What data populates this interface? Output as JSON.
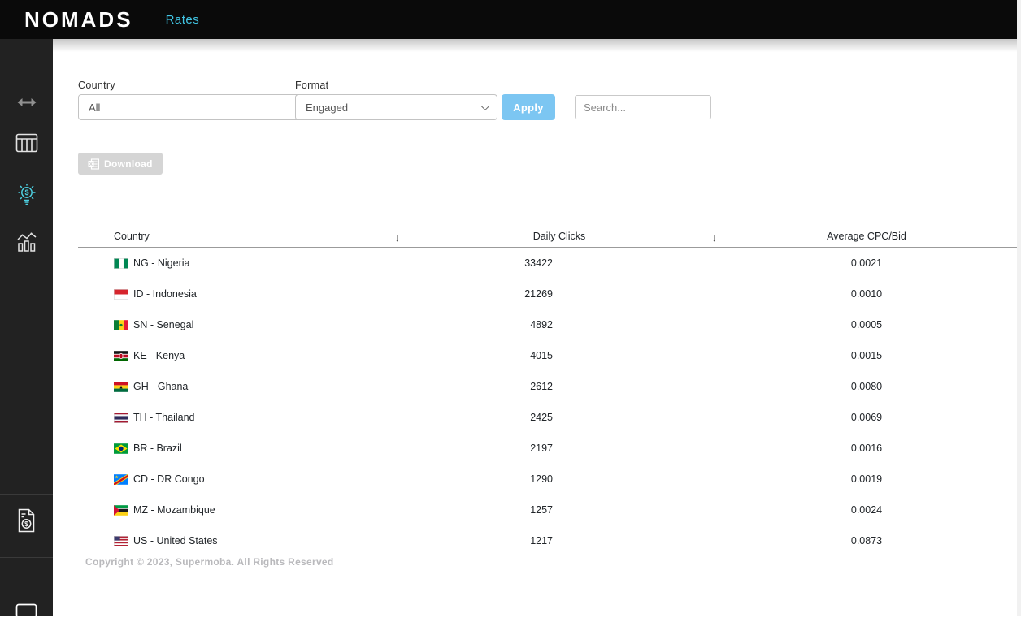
{
  "header": {
    "logo": "NOMADS",
    "rates_label": "Rates"
  },
  "sidebar": {
    "items": [
      {
        "icon": "resize-horizontal-icon"
      },
      {
        "icon": "table-columns-icon"
      },
      {
        "icon": "bulb-dollar-icon",
        "active": true
      },
      {
        "icon": "stats-chart-icon"
      },
      {
        "icon": "invoice-dollar-icon"
      },
      {
        "icon": "chat-icon"
      }
    ]
  },
  "filters": {
    "country": {
      "label": "Country",
      "value": "All"
    },
    "format": {
      "label": "Format",
      "value": "Engaged"
    },
    "apply_label": "Apply",
    "search_placeholder": "Search..."
  },
  "toolbar": {
    "download_label": "Download"
  },
  "table": {
    "sort_indicator": "↓",
    "columns": [
      {
        "label": "Country"
      },
      {
        "label": "Daily Clicks"
      },
      {
        "label": "Average CPC/Bid"
      }
    ],
    "rows": [
      {
        "code": "NG",
        "country": "NG - Nigeria",
        "daily_clicks": "33422",
        "avg_cpc_bid": "0.0021"
      },
      {
        "code": "ID",
        "country": "ID - Indonesia",
        "daily_clicks": "21269",
        "avg_cpc_bid": "0.0010"
      },
      {
        "code": "SN",
        "country": "SN - Senegal",
        "daily_clicks": "4892",
        "avg_cpc_bid": "0.0005"
      },
      {
        "code": "KE",
        "country": "KE - Kenya",
        "daily_clicks": "4015",
        "avg_cpc_bid": "0.0015"
      },
      {
        "code": "GH",
        "country": "GH - Ghana",
        "daily_clicks": "2612",
        "avg_cpc_bid": "0.0080"
      },
      {
        "code": "TH",
        "country": "TH - Thailand",
        "daily_clicks": "2425",
        "avg_cpc_bid": "0.0069"
      },
      {
        "code": "BR",
        "country": "BR - Brazil",
        "daily_clicks": "2197",
        "avg_cpc_bid": "0.0016"
      },
      {
        "code": "CD",
        "country": "CD - DR Congo",
        "daily_clicks": "1290",
        "avg_cpc_bid": "0.0019"
      },
      {
        "code": "MZ",
        "country": "MZ - Mozambique",
        "daily_clicks": "1257",
        "avg_cpc_bid": "0.0024"
      },
      {
        "code": "US",
        "country": "US - United States",
        "daily_clicks": "1217",
        "avg_cpc_bid": "0.0873"
      }
    ]
  },
  "footer": {
    "copyright": "Copyright © 2023, Supermoba. All Rights Reserved"
  },
  "colors": {
    "accent_cyan": "#41c6e5",
    "active_icon_cyan": "#4dd0e1",
    "apply_blue": "#7cc6f2",
    "header_bg": "#0a0a0a",
    "sidebar_bg": "#222222",
    "download_gray": "#d5d5d5"
  }
}
